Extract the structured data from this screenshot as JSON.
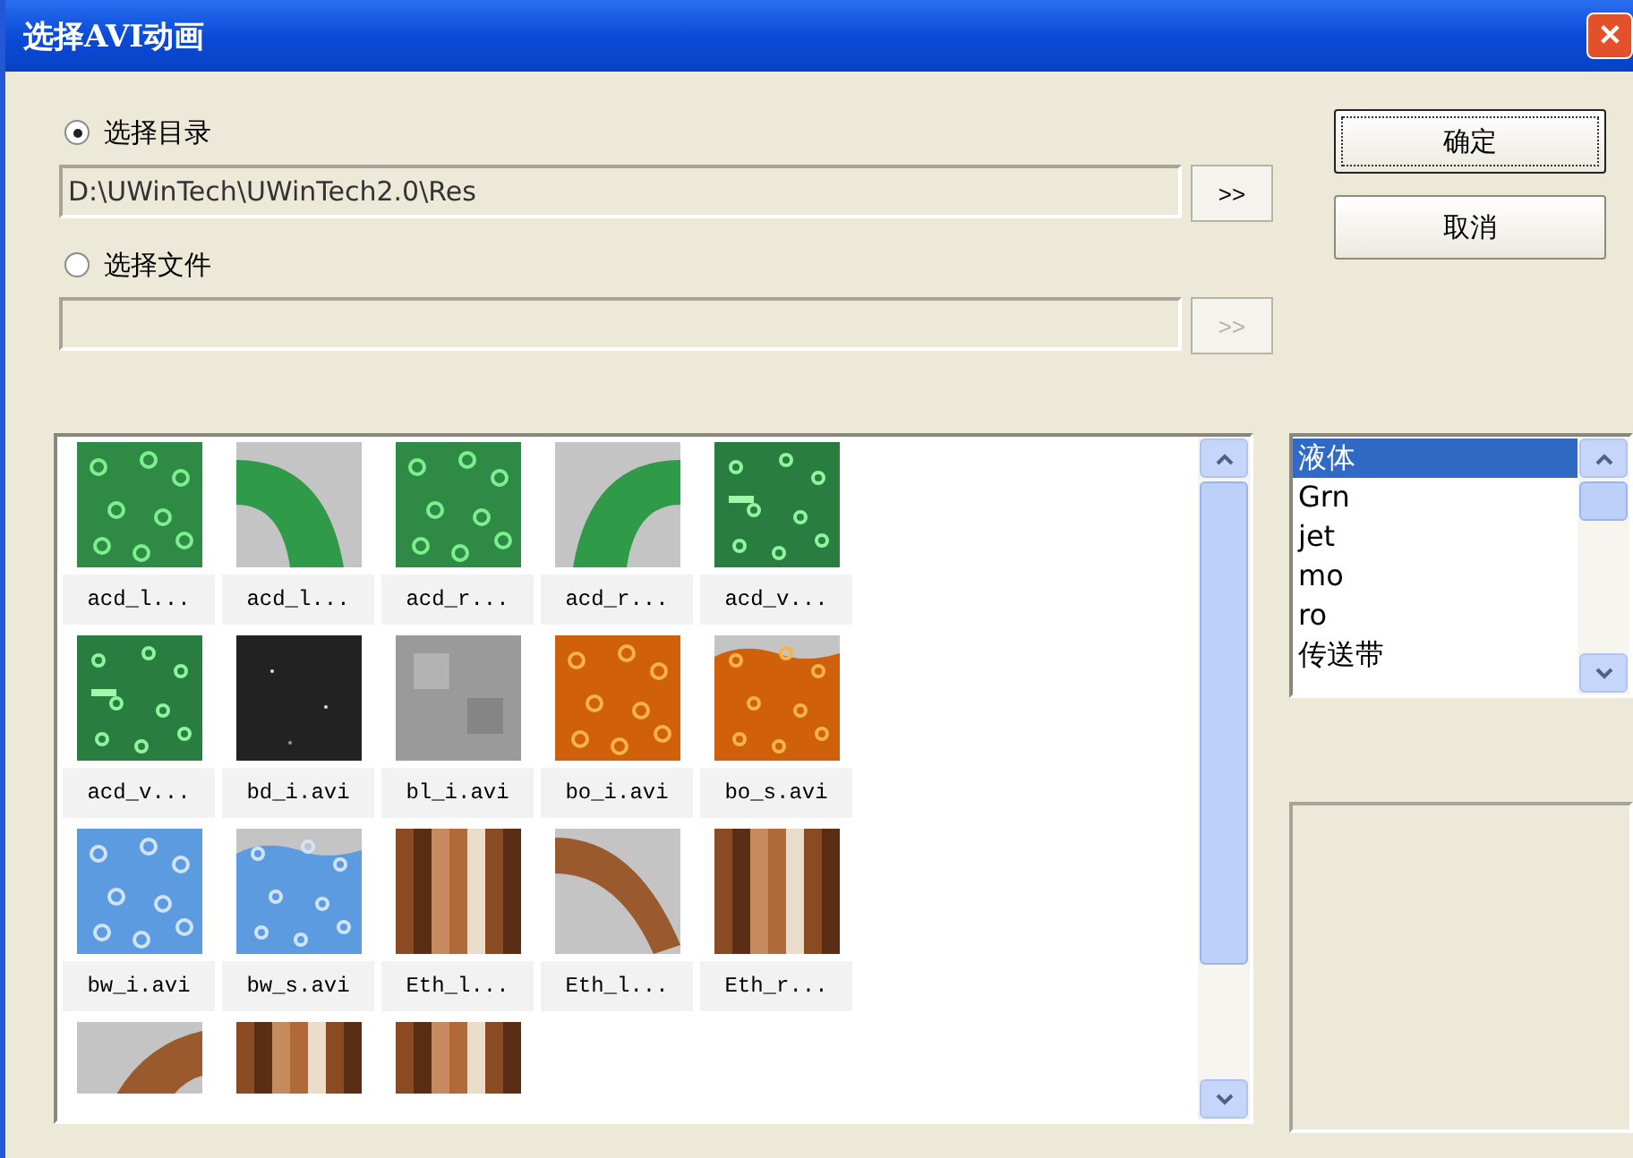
{
  "window": {
    "title": "选择AVI动画",
    "close": "✕"
  },
  "source_options": [
    {
      "label": "选择目录",
      "selected": true,
      "path": "D:\\UWinTech\\UWinTech2.0\\Res",
      "browse": ">>",
      "disabled": false
    },
    {
      "label": "选择文件",
      "selected": false,
      "browse": ">>",
      "disabled": true
    }
  ],
  "buttons": [
    {
      "label": "确定",
      "default": true
    },
    {
      "label": "取消",
      "default": false
    }
  ],
  "thumbnails": [
    {
      "label": "acd_l..."
    },
    {
      "label": "acd_l..."
    },
    {
      "label": "acd_r..."
    },
    {
      "label": "acd_r..."
    },
    {
      "label": "acd_v..."
    },
    {
      "label": "acd_v..."
    },
    {
      "label": "bd_i.avi"
    },
    {
      "label": "bl_i.avi"
    },
    {
      "label": "bo_i.avi"
    },
    {
      "label": "bo_s.avi"
    },
    {
      "label": "bw_i.avi"
    },
    {
      "label": "bw_s.avi"
    },
    {
      "label": "Eth_l..."
    },
    {
      "label": "Eth_l..."
    },
    {
      "label": "Eth_r..."
    },
    {
      "kind": "picture"
    },
    {
      "kind": "picture"
    },
    {
      "kind": "picture"
    }
  ],
  "categories": [
    {
      "label": "液体",
      "selected": true
    },
    {
      "label": "Grn",
      "selected": false
    },
    {
      "label": "jet",
      "selected": false
    },
    {
      "label": "mo",
      "selected": false
    },
    {
      "label": "ro",
      "selected": false
    },
    {
      "label": "传送带",
      "selected": false
    }
  ]
}
